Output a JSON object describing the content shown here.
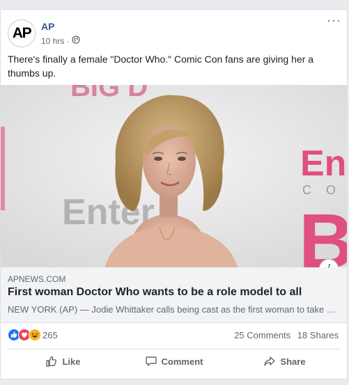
{
  "post": {
    "page_name": "AP",
    "avatar_text": "AP",
    "time": "10 hrs",
    "separator": "·",
    "caption": "There's finally a female \"Doctor Who.\" Comic Con fans are giving her a thumbs up.",
    "menu": "···"
  },
  "link": {
    "domain": "APNEWS.COM",
    "title": "First woman Doctor Who wants to be a role model to all",
    "description": "NEW YORK (AP) — Jodie Whittaker calls being cast as the first woman to take on the role of Doctor Who that she is overjoyed...",
    "info_label": "i"
  },
  "photo_backdrop": {
    "left_text": "Enter",
    "right_text_top": "Ente",
    "right_text_mid": "C O",
    "right_text_bottom": "B"
  },
  "stats": {
    "reaction_count": "265",
    "comments": "25 Comments",
    "shares": "18 Shares"
  },
  "actions": {
    "like": "Like",
    "comment": "Comment",
    "share": "Share"
  },
  "colors": {
    "link_blue": "#365899",
    "like_blue": "#1877f2",
    "love_red": "#f33e58",
    "haha_yellow": "#f7b125"
  }
}
